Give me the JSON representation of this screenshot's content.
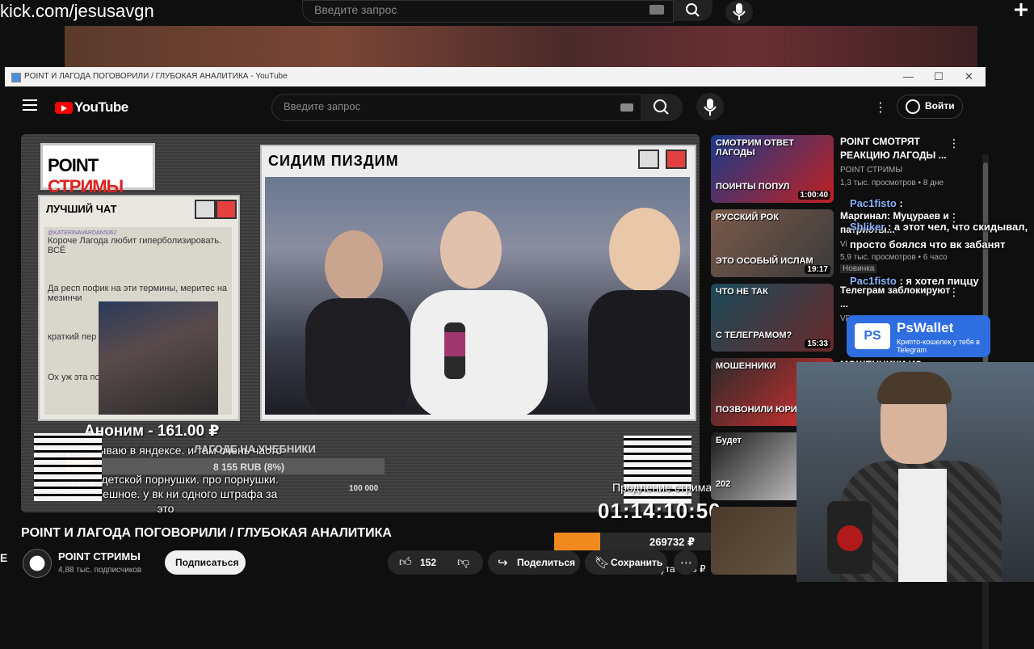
{
  "top": {
    "site_url": "kick.com/jesusavgn",
    "search_placeholder": "Введите запрос"
  },
  "window": {
    "title": "POINT И ЛАГОДА ПОГОВОРИЛИ / ГЛУБОКАЯ АНАЛИТИКА - YouTube",
    "controls": [
      "—",
      "☐",
      "✕"
    ]
  },
  "youtube": {
    "logo_text": "YouTube",
    "search_placeholder": "Введите запрос",
    "signin_label": "Войти"
  },
  "player": {
    "logo_point": "POINT",
    "logo_streams": "СТРИМЫ",
    "chat_box_title": "ЛУЧШИЙ ЧАТ",
    "chat_messages": [
      {
        "user": "@KATERINAVARDAN5062",
        "text": "Короче Лагода любит гиперболизировать. ВСЁ"
      },
      {
        "user": "",
        "text": "Да респ пофик на эти термины, меритес на мезинчи"
      },
      {
        "user": "",
        "text": "краткий пер"
      },
      {
        "user": "",
        "text": "Ох уж эта по слава не при"
      }
    ],
    "video_box_title": "СИДИМ ПИЗДИМ",
    "donation_title": "Аноним - 161.00 ₽",
    "donation_text": "подрабатываю в яндексе. и там очень часто приходят жалобы на дп из вк. вк просто похуище детской порнушки. про порнушки. самое смешное. у вк ни одного штрафа за это",
    "goal_label": "ЛАГОДЕ НА УЧЕБНИКИ",
    "goal_value": "8 155 RUB (8%)",
    "goal_percent": 8,
    "goal_max": "100 000",
    "prodl_label": "Продление стрима",
    "timer": "01:14:10:50",
    "money_total": "269732 ₽",
    "money_fill_percent": 19,
    "rate": "1 минута = 75 ₽"
  },
  "video": {
    "title": "POINT И ЛАГОДА ПОГОВОРИЛИ / ГЛУБОКАЯ АНАЛИТИКА",
    "channel_name": "POINT СТРИМЫ",
    "channel_subs": "4,88 тыс. подписчиков",
    "subscribe_label": "Подписаться",
    "likes": "152",
    "share_label": "Поделиться",
    "save_label": "Сохранить"
  },
  "sidebar": {
    "items": [
      {
        "thumb_caption": "СМОТРИМ ОТВЕТ ЛАГОДЫ",
        "thumb_caption2": "ПОИНТЫ ПОПУЛ",
        "duration": "1:00:40",
        "title": "POINT СМОТРЯТ РЕАКЦИЮ ЛАГОДЫ ...",
        "channel": "POINT СТРИМЫ",
        "meta": "1,3 тыс. просмотров • 8 дне",
        "color1": "#1a3a8a",
        "color2": "#c02020"
      },
      {
        "thumb_caption": "РУССКИЙ РОК",
        "thumb_caption2": "ЭТО ОСОБЫЙ ИСЛАМ",
        "duration": "19:17",
        "title": "Маргинал: Муцураев и патриоты...",
        "channel": "Vi",
        "meta": "5,9 тыс. просмотров • 6 часо",
        "badge": "Новинка",
        "color1": "#7a5a4a",
        "color2": "#3a3a3a"
      },
      {
        "thumb_caption": "ЧТО НЕ ТАК",
        "thumb_caption2": "С ТЕЛЕГРАМОМ?",
        "duration": "15:33",
        "title": "Телеграм заблокируют ...",
        "channel": "VP",
        "meta": "",
        "color1": "#1a4a5a",
        "color2": "#6a2a2a"
      },
      {
        "thumb_caption": "МОШЕННИКИ",
        "thumb_caption2": "ПОЗВОНИЛИ ЮРИ",
        "duration": "",
        "title": "МОШЕННИКИ ИЗ...",
        "channel": "",
        "meta": "",
        "color1": "#2a2a2a",
        "color2": "#e03030"
      },
      {
        "thumb_caption": "Будет",
        "thumb_caption2": "202",
        "duration": "",
        "title": "",
        "channel": "",
        "meta": "",
        "color1": "#1a1a1a",
        "color2": "#e0e0e0"
      },
      {
        "thumb_caption": "",
        "thumb_caption2": "",
        "duration": "",
        "title": "",
        "channel": "",
        "meta": "",
        "color1": "#4a3a2a",
        "color2": "#6a5a4a"
      }
    ]
  },
  "overlay_chat": [
    {
      "name": "Pac1fisto",
      "text": ":"
    },
    {
      "name": "Shliker",
      "text": ": а этот чел, что скидывал, просто боялся что вк забанят"
    },
    {
      "name": "Pac1fisto",
      "text": ": я хотел пиццу"
    }
  ],
  "pswallet": {
    "logo": "PS",
    "name": "PsWallet",
    "tagline": "Крипто-кошелек у тебя в Telegram"
  },
  "colors": {
    "youtube_red": "#ff0000",
    "accent_orange": "#f08a1e",
    "pswallet_blue": "#2f6ee0"
  }
}
